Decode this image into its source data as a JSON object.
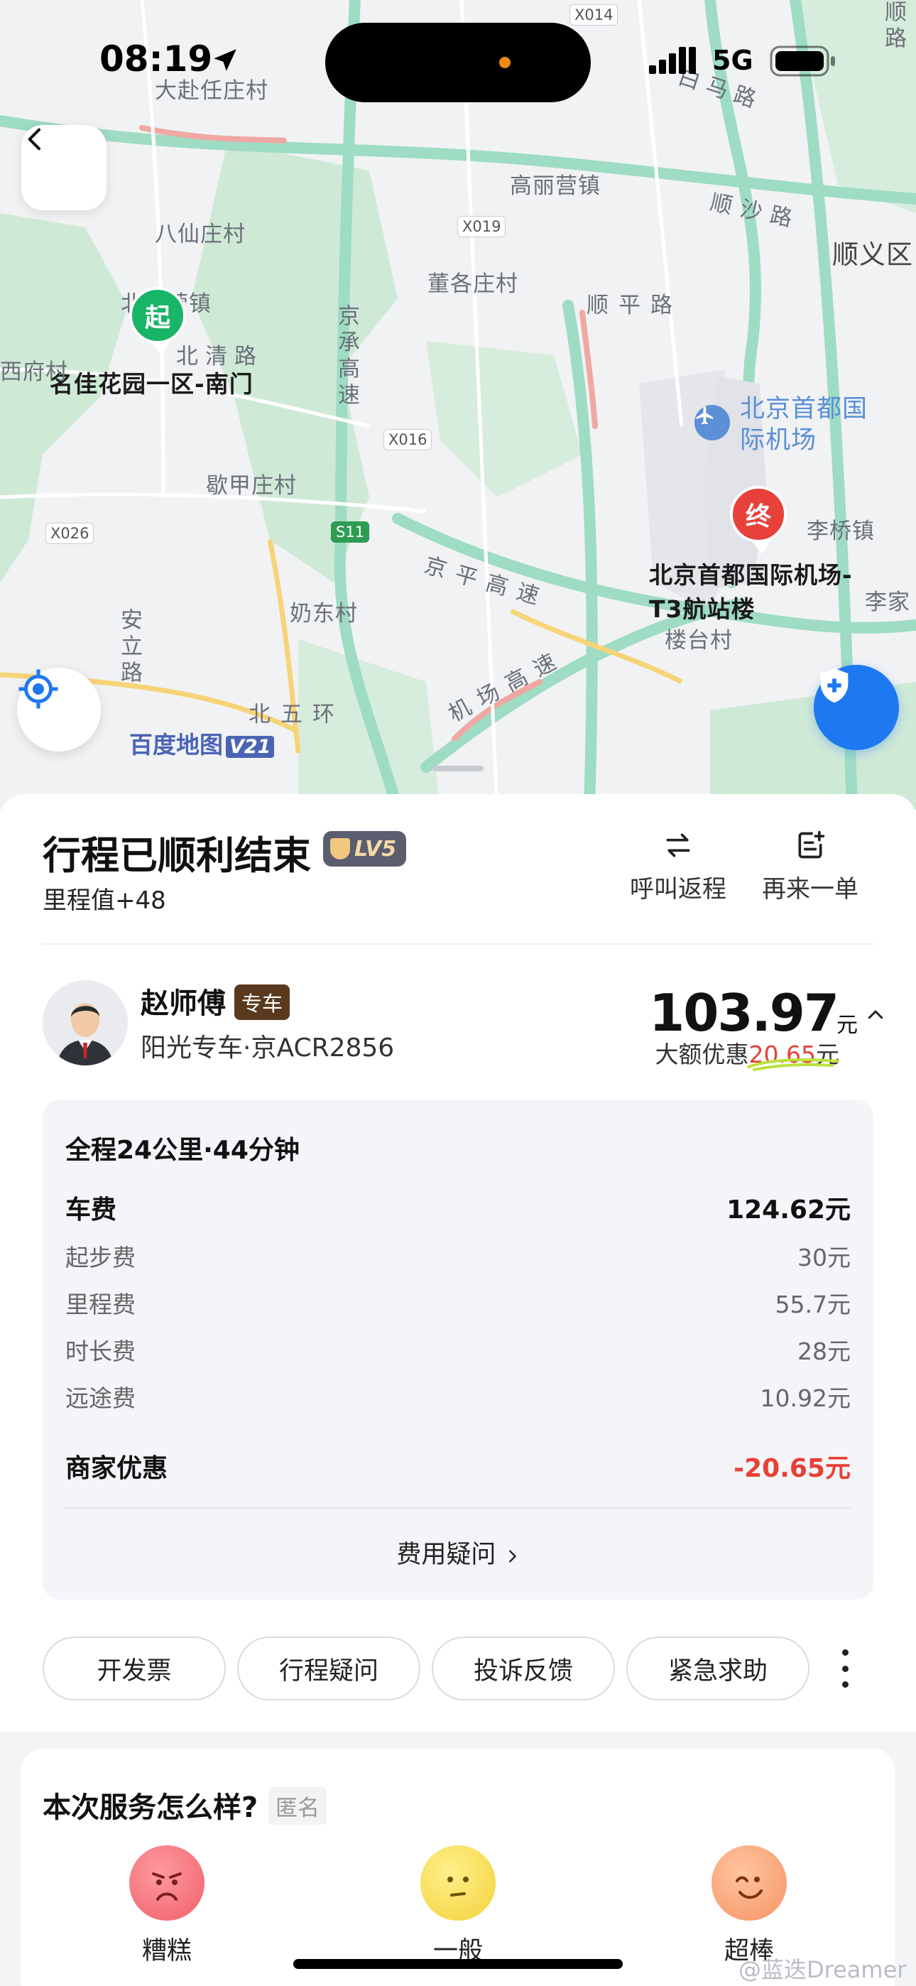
{
  "status_bar": {
    "time": "08:19",
    "network": "5G"
  },
  "map": {
    "labels": [
      "大赴任庄村",
      "八仙庄村",
      "北小营镇",
      "北清路",
      "名佳花园一区-南门",
      "西府村",
      "歇甲庄村",
      "奶东村",
      "北五环",
      "安立路",
      "高丽营镇",
      "董各庄村",
      "顺沙路",
      "顺平路",
      "顺义区",
      "京承高速",
      "京平高速",
      "机场高速",
      "李桥镇",
      "李家",
      "楼台村",
      "白马路",
      "顺路"
    ],
    "road_codes": [
      "X014",
      "X019",
      "X016",
      "X026",
      "S11"
    ],
    "airport": "北京首都国际机场",
    "destination": "北京首都国际机场-T3航站楼",
    "start_marker": "起",
    "end_marker": "终",
    "baidu_logo": "百度地图",
    "baidu_version": "V21",
    "watermark": "@蓝迭Dreamer"
  },
  "trip": {
    "title": "行程已顺利结束",
    "level": "LV5",
    "mileage": "里程值+48",
    "actions": [
      {
        "label": "呼叫返程",
        "icon": "swap-arrows-icon"
      },
      {
        "label": "再来一单",
        "icon": "reorder-icon"
      }
    ]
  },
  "driver": {
    "name": "赵师傅",
    "tag": "专车",
    "car": "阳光专车·京ACR2856",
    "price": "103.97",
    "price_unit": "元",
    "discount_label": "大额优惠",
    "discount_value": "20.65",
    "discount_unit": "元"
  },
  "fees": {
    "summary": "全程24公里·44分钟",
    "car_fee_label": "车费",
    "car_fee_value": "124.62元",
    "items": [
      {
        "label": "起步费",
        "value": "30元"
      },
      {
        "label": "里程费",
        "value": "55.7元"
      },
      {
        "label": "时长费",
        "value": "28元"
      },
      {
        "label": "远途费",
        "value": "10.92元"
      }
    ],
    "merchant_label": "商家优惠",
    "merchant_value": "-20.65元",
    "question": "费用疑问"
  },
  "buttons": [
    "开发票",
    "行程疑问",
    "投诉反馈",
    "紧急求助"
  ],
  "rating": {
    "question": "本次服务怎么样?",
    "anonymous": "匿名",
    "options": [
      {
        "label": "糟糕",
        "color": "#f26b73"
      },
      {
        "label": "一般",
        "color": "#f5d94a"
      },
      {
        "label": "超棒",
        "color": "#f7a36e"
      }
    ]
  },
  "colors": {
    "accent_blue": "#1e78f2",
    "red": "#e84036",
    "start_green": "#18b566"
  }
}
